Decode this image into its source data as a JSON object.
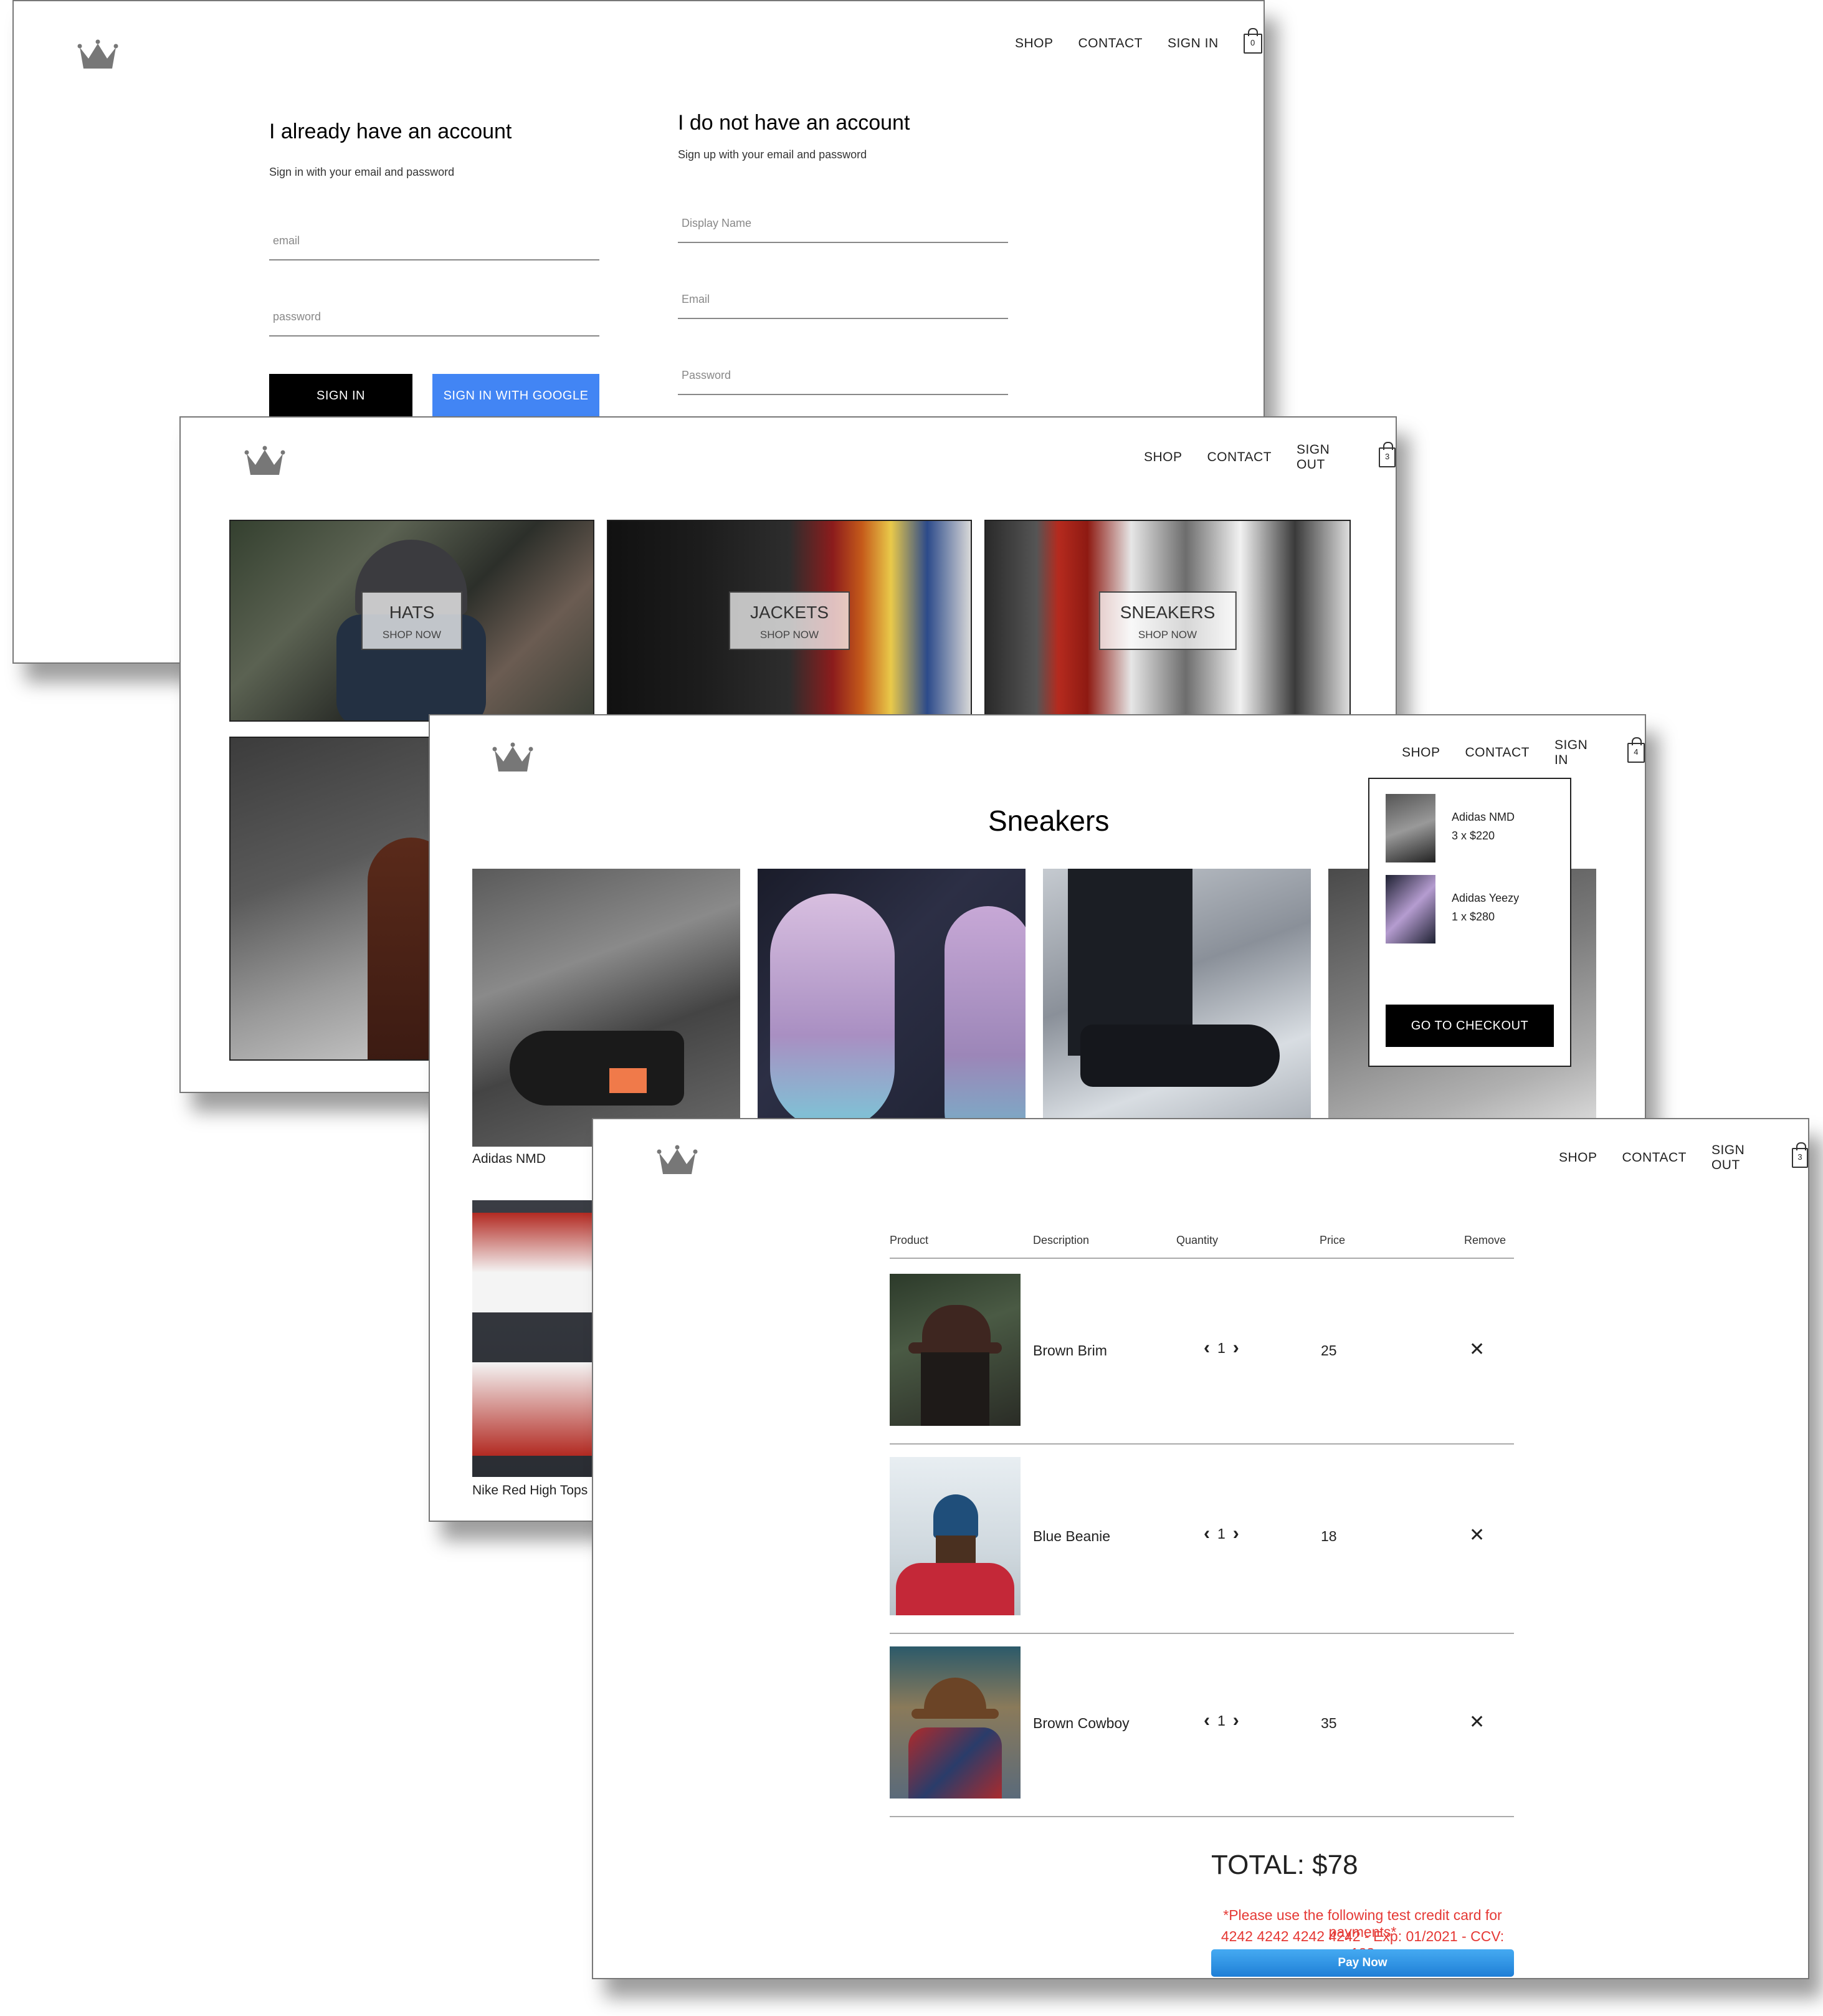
{
  "brand": {
    "logo_icon": "crown-icon"
  },
  "signin_page": {
    "nav": {
      "shop": "SHOP",
      "contact": "CONTACT",
      "auth": "SIGN IN",
      "cart_count": "0"
    },
    "signin": {
      "title": "I already have an account",
      "subtitle": "Sign in with your email and password",
      "email_placeholder": "email",
      "password_placeholder": "password",
      "signin_button": "SIGN IN",
      "google_button": "SIGN IN WITH GOOGLE"
    },
    "signup": {
      "title": "I do not have an account",
      "subtitle": "Sign up with your email and password",
      "display_name_placeholder": "Display Name",
      "email_placeholder": "Email",
      "password_placeholder": "Password"
    }
  },
  "home_page": {
    "nav": {
      "shop": "SHOP",
      "contact": "CONTACT",
      "auth": "SIGN OUT",
      "cart_count": "3"
    },
    "categories": [
      {
        "title": "HATS",
        "subtitle": "SHOP NOW"
      },
      {
        "title": "JACKETS",
        "subtitle": "SHOP NOW"
      },
      {
        "title": "SNEAKERS",
        "subtitle": "SHOP NOW"
      }
    ]
  },
  "collection_page": {
    "nav": {
      "shop": "SHOP",
      "contact": "CONTACT",
      "auth": "SIGN IN",
      "cart_count": "4"
    },
    "title": "Sneakers",
    "products": [
      {
        "name": "Adidas NMD"
      },
      {
        "name": "Nike Red High Tops"
      }
    ],
    "cart_dropdown": {
      "items": [
        {
          "name": "Adidas NMD",
          "qty_price": "3 x $220"
        },
        {
          "name": "Adidas Yeezy",
          "qty_price": "1 x $280"
        }
      ],
      "checkout_button": "GO TO CHECKOUT"
    }
  },
  "checkout_page": {
    "nav": {
      "shop": "SHOP",
      "contact": "CONTACT",
      "auth": "SIGN OUT",
      "cart_count": "3"
    },
    "headers": {
      "product": "Product",
      "description": "Description",
      "quantity": "Quantity",
      "price": "Price",
      "remove": "Remove"
    },
    "items": [
      {
        "description": "Brown Brim",
        "quantity": "1",
        "price": "25"
      },
      {
        "description": "Blue Beanie",
        "quantity": "1",
        "price": "18"
      },
      {
        "description": "Brown Cowboy",
        "quantity": "1",
        "price": "35"
      }
    ],
    "total": "TOTAL: $78",
    "warning_line1": "*Please use the following test credit card for payments*",
    "warning_line2": "4242 4242 4242 4242 - Exp: 01/2021 - CCV: 123",
    "pay_button": "Pay Now"
  }
}
